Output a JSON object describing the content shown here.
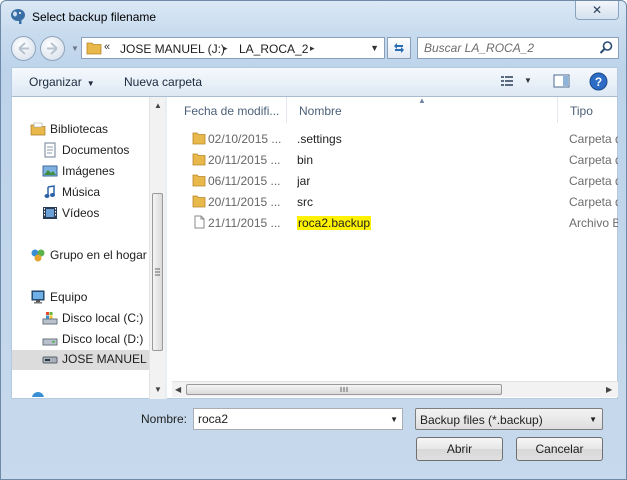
{
  "window": {
    "title": "Select backup filename",
    "close_glyph": "✕"
  },
  "address_bar": {
    "prefix": "«",
    "crumbs": [
      "JOSE MANUEL (J:)",
      "LA_ROCA_2"
    ],
    "separator": "▸",
    "dropdown_glyph": "▼"
  },
  "search": {
    "placeholder": "Buscar LA_ROCA_2"
  },
  "toolbar": {
    "organize_label": "Organizar",
    "new_folder_label": "Nueva carpeta",
    "dropdown_glyph": "▼"
  },
  "nav_tree": {
    "items": [
      {
        "label": "Bibliotecas",
        "icon": "libraries-icon"
      },
      {
        "label": "Documentos",
        "icon": "documents-icon"
      },
      {
        "label": "Imágenes",
        "icon": "pictures-icon"
      },
      {
        "label": "Música",
        "icon": "music-icon"
      },
      {
        "label": "Vídeos",
        "icon": "videos-icon"
      },
      {
        "label": "Grupo en el hogar",
        "icon": "homegroup-icon"
      },
      {
        "label": "Equipo",
        "icon": "computer-icon"
      },
      {
        "label": "Disco local (C:)",
        "icon": "local-disk-icon"
      },
      {
        "label": "Disco local (D:)",
        "icon": "local-disk-icon"
      },
      {
        "label": "JOSE MANUEL (",
        "icon": "removable-drive-icon"
      }
    ]
  },
  "columns": {
    "date": "Fecha de modifi...",
    "name": "Nombre",
    "type": "Tipo"
  },
  "files": [
    {
      "date": "02/10/2015 ...",
      "name": ".settings",
      "type": "Carpeta de",
      "kind": "folder"
    },
    {
      "date": "20/11/2015 ...",
      "name": "bin",
      "type": "Carpeta de",
      "kind": "folder"
    },
    {
      "date": "06/11/2015 ...",
      "name": "jar",
      "type": "Carpeta de",
      "kind": "folder"
    },
    {
      "date": "20/11/2015 ...",
      "name": "src",
      "type": "Carpeta de",
      "kind": "folder"
    },
    {
      "date": "21/11/2015 ...",
      "name": "roca2.backup",
      "type": "Archivo BA",
      "kind": "file"
    }
  ],
  "footer": {
    "name_label": "Nombre:",
    "name_value": "roca2",
    "filter_value": "Backup files (*.backup)",
    "open_label": "Abrir",
    "cancel_label": "Cancelar"
  },
  "colors": {
    "highlight": "#fff200",
    "folder": "#e8b84a",
    "accent": "#1f6fc1"
  }
}
